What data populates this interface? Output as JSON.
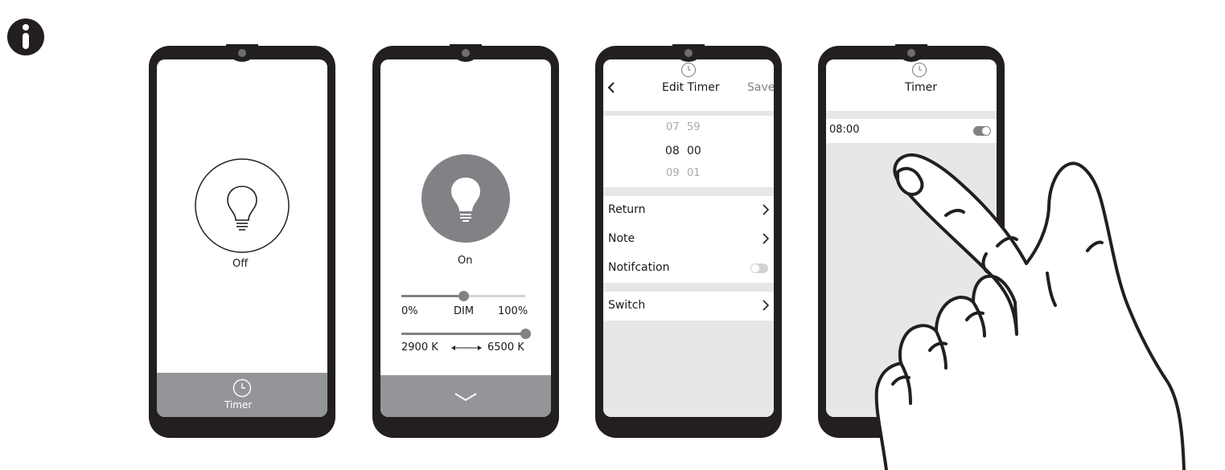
{
  "info_badge": {
    "icon": "info-icon"
  },
  "phone1": {
    "status": "Off",
    "timer_label": "Timer"
  },
  "phone2": {
    "status": "On",
    "dim": {
      "min_label": "0%",
      "label": "DIM",
      "max_label": "100%",
      "level": 0.5
    },
    "cct": {
      "min_label": "2900 K",
      "max_label": "6500 K",
      "level": 1.0
    }
  },
  "phone3": {
    "title": "Edit Timer",
    "save_label": "Save",
    "picker": {
      "prev": {
        "hour": "07",
        "minute": "59"
      },
      "current": {
        "hour": "08",
        "minute": "00"
      },
      "next": {
        "hour": "09",
        "minute": "01"
      }
    },
    "rows": {
      "return_label": "Return",
      "note_label": "Note",
      "notification_label": "Notifcation",
      "switch_label": "Switch"
    }
  },
  "phone4": {
    "title": "Timer",
    "timer_entry": "08:00"
  },
  "colors": {
    "bezel": "#231f20",
    "accent_gray": "#939598",
    "panel_gray": "#e6e7e8"
  }
}
